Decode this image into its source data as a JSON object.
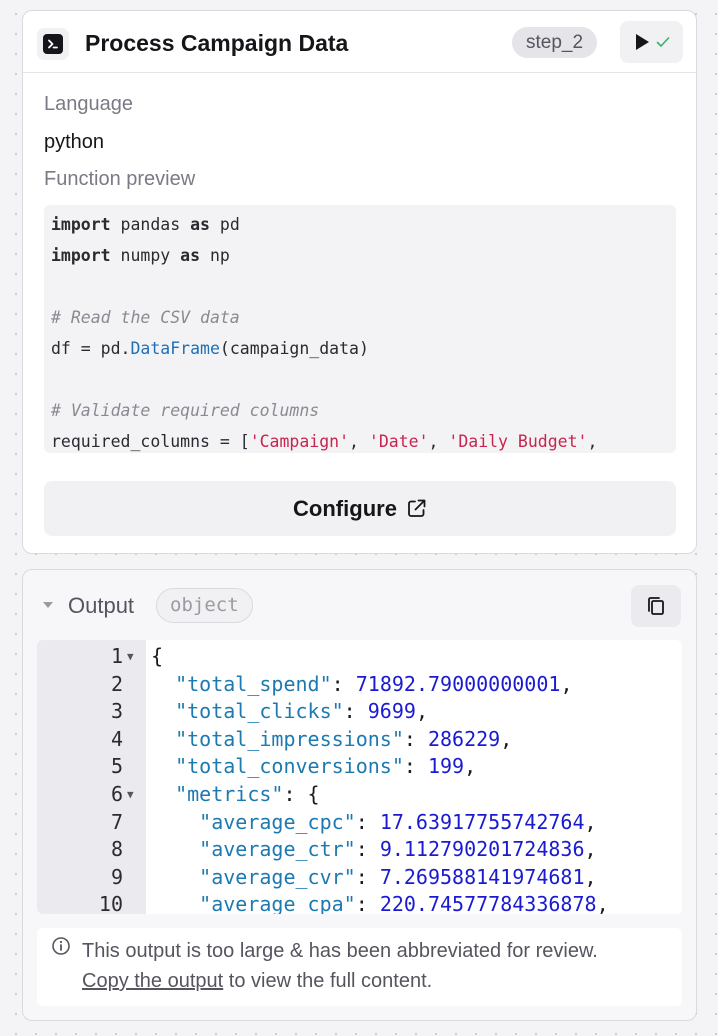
{
  "step_card": {
    "title": "Process Campaign Data",
    "step_badge": "step_2",
    "language_label": "Language",
    "language_value": "python",
    "preview_label": "Function preview",
    "code_lines": [
      [
        {
          "t": "import",
          "c": "kw"
        },
        {
          "t": " pandas ",
          "c": ""
        },
        {
          "t": "as",
          "c": "kw"
        },
        {
          "t": " pd",
          "c": ""
        }
      ],
      [
        {
          "t": "import",
          "c": "kw"
        },
        {
          "t": " numpy ",
          "c": ""
        },
        {
          "t": "as",
          "c": "kw"
        },
        {
          "t": " np",
          "c": ""
        }
      ],
      [],
      [
        {
          "t": "# Read the CSV data",
          "c": "cm"
        }
      ],
      [
        {
          "t": "df = pd.",
          "c": ""
        },
        {
          "t": "DataFrame",
          "c": "fn"
        },
        {
          "t": "(campaign_data)",
          "c": ""
        }
      ],
      [],
      [
        {
          "t": "# Validate required columns",
          "c": "cm"
        }
      ],
      [
        {
          "t": "required_columns = [",
          "c": ""
        },
        {
          "t": "'Campaign'",
          "c": "st"
        },
        {
          "t": ", ",
          "c": ""
        },
        {
          "t": "'Date'",
          "c": "st"
        },
        {
          "t": ", ",
          "c": ""
        },
        {
          "t": "'Daily Budget'",
          "c": "st"
        },
        {
          "t": ",",
          "c": ""
        }
      ]
    ],
    "configure_label": "Configure"
  },
  "output": {
    "label": "Output",
    "type_badge": "object",
    "json_lines": [
      {
        "n": "1",
        "fold": true,
        "parts": [
          {
            "t": "{",
            "c": ""
          }
        ]
      },
      {
        "n": "2",
        "fold": false,
        "parts": [
          {
            "t": "  ",
            "c": ""
          },
          {
            "t": "\"total_spend\"",
            "c": "jkey"
          },
          {
            "t": ": ",
            "c": ""
          },
          {
            "t": "71892.79000000001",
            "c": "jnum"
          },
          {
            "t": ",",
            "c": ""
          }
        ]
      },
      {
        "n": "3",
        "fold": false,
        "parts": [
          {
            "t": "  ",
            "c": ""
          },
          {
            "t": "\"total_clicks\"",
            "c": "jkey"
          },
          {
            "t": ": ",
            "c": ""
          },
          {
            "t": "9699",
            "c": "jnum"
          },
          {
            "t": ",",
            "c": ""
          }
        ]
      },
      {
        "n": "4",
        "fold": false,
        "parts": [
          {
            "t": "  ",
            "c": ""
          },
          {
            "t": "\"total_impressions\"",
            "c": "jkey"
          },
          {
            "t": ": ",
            "c": ""
          },
          {
            "t": "286229",
            "c": "jnum"
          },
          {
            "t": ",",
            "c": ""
          }
        ]
      },
      {
        "n": "5",
        "fold": false,
        "parts": [
          {
            "t": "  ",
            "c": ""
          },
          {
            "t": "\"total_conversions\"",
            "c": "jkey"
          },
          {
            "t": ": ",
            "c": ""
          },
          {
            "t": "199",
            "c": "jnum"
          },
          {
            "t": ",",
            "c": ""
          }
        ]
      },
      {
        "n": "6",
        "fold": true,
        "parts": [
          {
            "t": "  ",
            "c": ""
          },
          {
            "t": "\"metrics\"",
            "c": "jkey"
          },
          {
            "t": ": {",
            "c": ""
          }
        ]
      },
      {
        "n": "7",
        "fold": false,
        "parts": [
          {
            "t": "    ",
            "c": ""
          },
          {
            "t": "\"average_cpc\"",
            "c": "jkey"
          },
          {
            "t": ": ",
            "c": ""
          },
          {
            "t": "17.63917755742764",
            "c": "jnum"
          },
          {
            "t": ",",
            "c": ""
          }
        ]
      },
      {
        "n": "8",
        "fold": false,
        "parts": [
          {
            "t": "    ",
            "c": ""
          },
          {
            "t": "\"average_ctr\"",
            "c": "jkey"
          },
          {
            "t": ": ",
            "c": ""
          },
          {
            "t": "9.112790201724836",
            "c": "jnum"
          },
          {
            "t": ",",
            "c": ""
          }
        ]
      },
      {
        "n": "9",
        "fold": false,
        "parts": [
          {
            "t": "    ",
            "c": ""
          },
          {
            "t": "\"average_cvr\"",
            "c": "jkey"
          },
          {
            "t": ": ",
            "c": ""
          },
          {
            "t": "7.269588141974681",
            "c": "jnum"
          },
          {
            "t": ",",
            "c": ""
          }
        ]
      },
      {
        "n": "10",
        "fold": false,
        "parts": [
          {
            "t": "    ",
            "c": ""
          },
          {
            "t": "\"average_cpa\"",
            "c": "jkey"
          },
          {
            "t": ": ",
            "c": ""
          },
          {
            "t": "220.74577784336878",
            "c": "jnum"
          },
          {
            "t": ",",
            "c": ""
          }
        ]
      }
    ],
    "notice_text": "This output is too large & has been abbreviated for review.",
    "notice_link": "Copy the output",
    "notice_suffix": " to view the full content."
  },
  "icons": {
    "terminal": "terminal-icon",
    "run": "play-icon",
    "status": "check-icon",
    "configure": "external-link-icon",
    "collapse": "caret-down-icon",
    "copy": "copy-icon",
    "info": "info-icon"
  },
  "colors": {
    "success_check": "#3fae6a",
    "json_key": "#1d7ab0",
    "json_number": "#1a1ad1",
    "code_string": "#c7254e",
    "code_function": "#1f6fb5"
  }
}
